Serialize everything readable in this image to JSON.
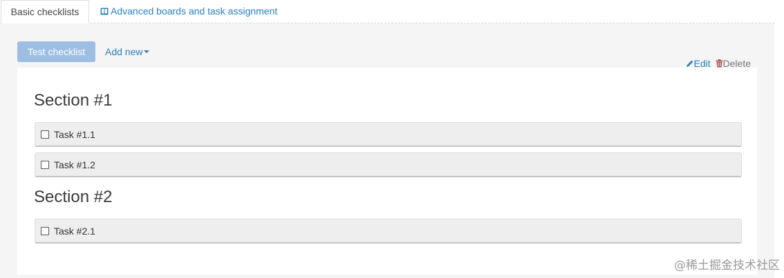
{
  "tabs": [
    {
      "label": "Basic checklists",
      "active": true
    },
    {
      "label": "Advanced boards and task assignment",
      "active": false,
      "icon": "book-icon"
    }
  ],
  "toolbar": {
    "test_checklist_label": "Test checklist",
    "add_new_label": "Add new"
  },
  "actions": {
    "edit_label": "Edit",
    "delete_label": "Delete"
  },
  "sections": [
    {
      "title": "Section #1",
      "tasks": [
        {
          "label": "Task #1.1",
          "checked": false
        },
        {
          "label": "Task #1.2",
          "checked": false
        }
      ]
    },
    {
      "title": "Section #2",
      "tasks": [
        {
          "label": "Task #2.1",
          "checked": false
        }
      ]
    }
  ],
  "colors": {
    "link": "#2a7fba",
    "primary_button_disabled": "#9cbee3",
    "content_background": "#f5f5f5",
    "task_background": "#eeeeee"
  },
  "watermark": "@稀土掘金技术社区"
}
